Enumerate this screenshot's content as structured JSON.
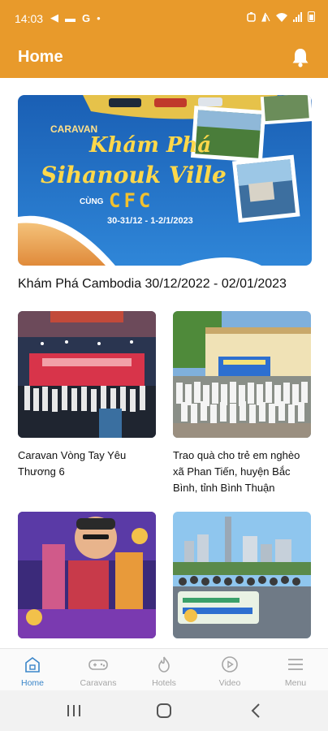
{
  "status_bar": {
    "time": "14:03",
    "left_glyphs": [
      "◀",
      "▬",
      "G",
      "•"
    ]
  },
  "header": {
    "title": "Home"
  },
  "feature": {
    "banner_text": {
      "caravan": "CARAVAN",
      "kham_pha": "Khám Phá",
      "destination": "Sihanouk Ville",
      "cung": "CÙNG",
      "brand": "CFC",
      "dates": "30-31/12 - 1-2/1/2023"
    },
    "title": "Khám Phá Cambodia 30/12/2022 - 02/01/2023"
  },
  "posts": [
    {
      "caption": "Caravan Vòng Tay Yêu Thương 6"
    },
    {
      "caption": "Trao quà cho trẻ em nghèo xã Phan Tiến, huyện Bắc Bình, tỉnh Bình Thuận"
    },
    {
      "caption": ""
    },
    {
      "caption": ""
    }
  ],
  "bottom_nav": [
    {
      "label": "Home",
      "icon": "home-icon",
      "active": true
    },
    {
      "label": "Caravans",
      "icon": "gamepad-icon",
      "active": false
    },
    {
      "label": "Hotels",
      "icon": "flame-icon",
      "active": false
    },
    {
      "label": "Video",
      "icon": "play-circle-icon",
      "active": false
    },
    {
      "label": "Menu",
      "icon": "menu-icon",
      "active": false
    }
  ],
  "colors": {
    "brand": "#e89a2b",
    "active": "#3b86c9",
    "inactive": "#a6a6a6"
  }
}
